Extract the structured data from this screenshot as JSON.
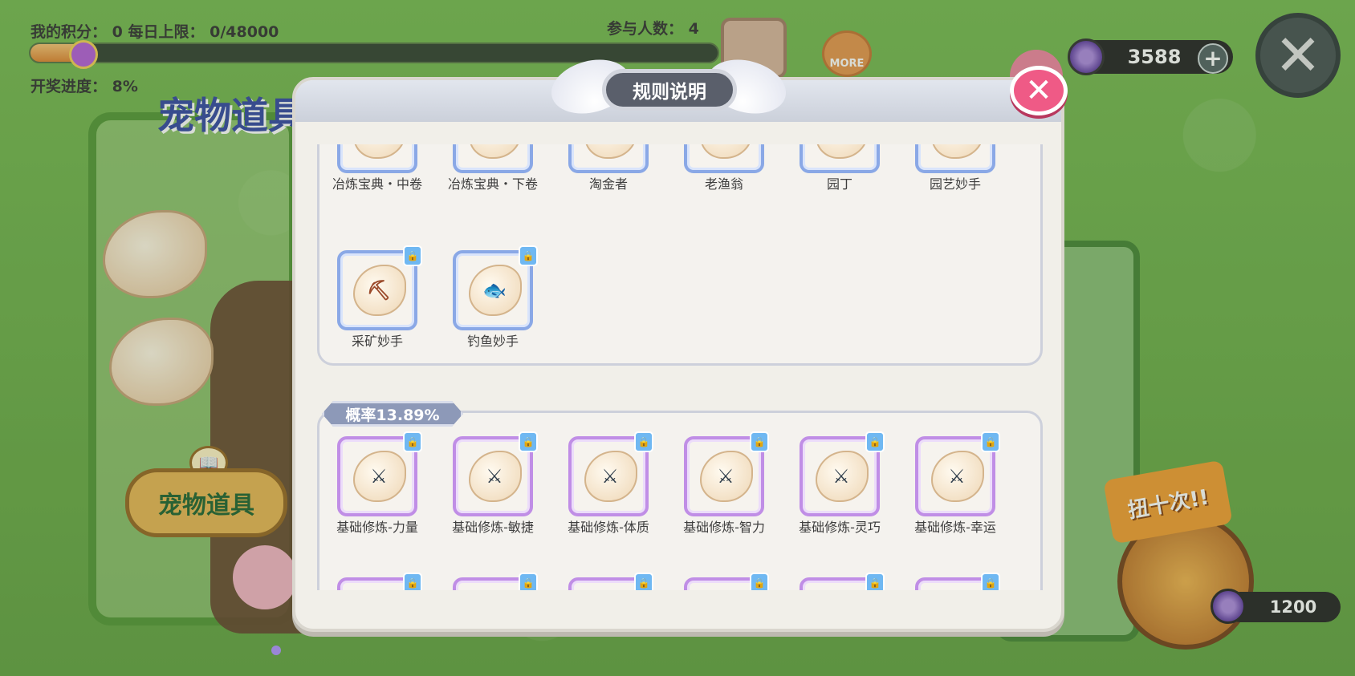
{
  "hud": {
    "score_label": "我的积分：",
    "score_value": "0",
    "daily_limit_label": "每日上限：",
    "daily_limit_value": "0/48000",
    "participants_label": "参与人数：",
    "participants_value": "4",
    "lottery_label": "开奖进度：",
    "lottery_value": "8%",
    "lottery_progress_fraction": 0.08,
    "more_label": "MORE",
    "currency_value": "3588",
    "plus_symbol": "+"
  },
  "left_panel": {
    "title": "宠物道具",
    "button_label": "宠物道具"
  },
  "right_panel": {
    "spin_label": "扭十次!!",
    "cost_value": "1200"
  },
  "modal": {
    "title": "规则说明",
    "close_symbol": "✕",
    "section1_items": [
      {
        "label": "冶炼宝典・中卷",
        "emblem": "pickaxe-emblem",
        "locked": false
      },
      {
        "label": "冶炼宝典・下卷",
        "emblem": "pickaxe-emblem",
        "locked": false
      },
      {
        "label": "淘金者",
        "emblem": "pickaxe-emblem",
        "locked": false
      },
      {
        "label": "老渔翁",
        "emblem": "fish-emblem",
        "locked": false
      },
      {
        "label": "园丁",
        "emblem": "leaf-emblem",
        "locked": false
      },
      {
        "label": "园艺妙手",
        "emblem": "leaf-emblem",
        "locked": false
      },
      {
        "label": "采矿妙手",
        "emblem": "pickaxe-emblem",
        "locked": true
      },
      {
        "label": "钓鱼妙手",
        "emblem": "fish-emblem",
        "locked": true
      }
    ],
    "section2_probability": "概率13.89%",
    "section2_items": [
      {
        "label": "基础修炼-力量",
        "emblem": "crossed-swords-emblem",
        "locked": true
      },
      {
        "label": "基础修炼-敏捷",
        "emblem": "crossed-swords-emblem",
        "locked": true
      },
      {
        "label": "基础修炼-体质",
        "emblem": "crossed-swords-emblem",
        "locked": true
      },
      {
        "label": "基础修炼-智力",
        "emblem": "crossed-swords-emblem",
        "locked": true
      },
      {
        "label": "基础修炼-灵巧",
        "emblem": "crossed-swords-emblem",
        "locked": true
      },
      {
        "label": "基础修炼-幸运",
        "emblem": "crossed-swords-emblem",
        "locked": true
      }
    ]
  },
  "colors": {
    "background": "#74b453",
    "modal_bg": "#f1efe9",
    "blue_frame": "#8aa8e6",
    "purple_frame": "#c08ee6",
    "close_pink": "#ef5a86",
    "prob_tag": "#8d99b8"
  }
}
